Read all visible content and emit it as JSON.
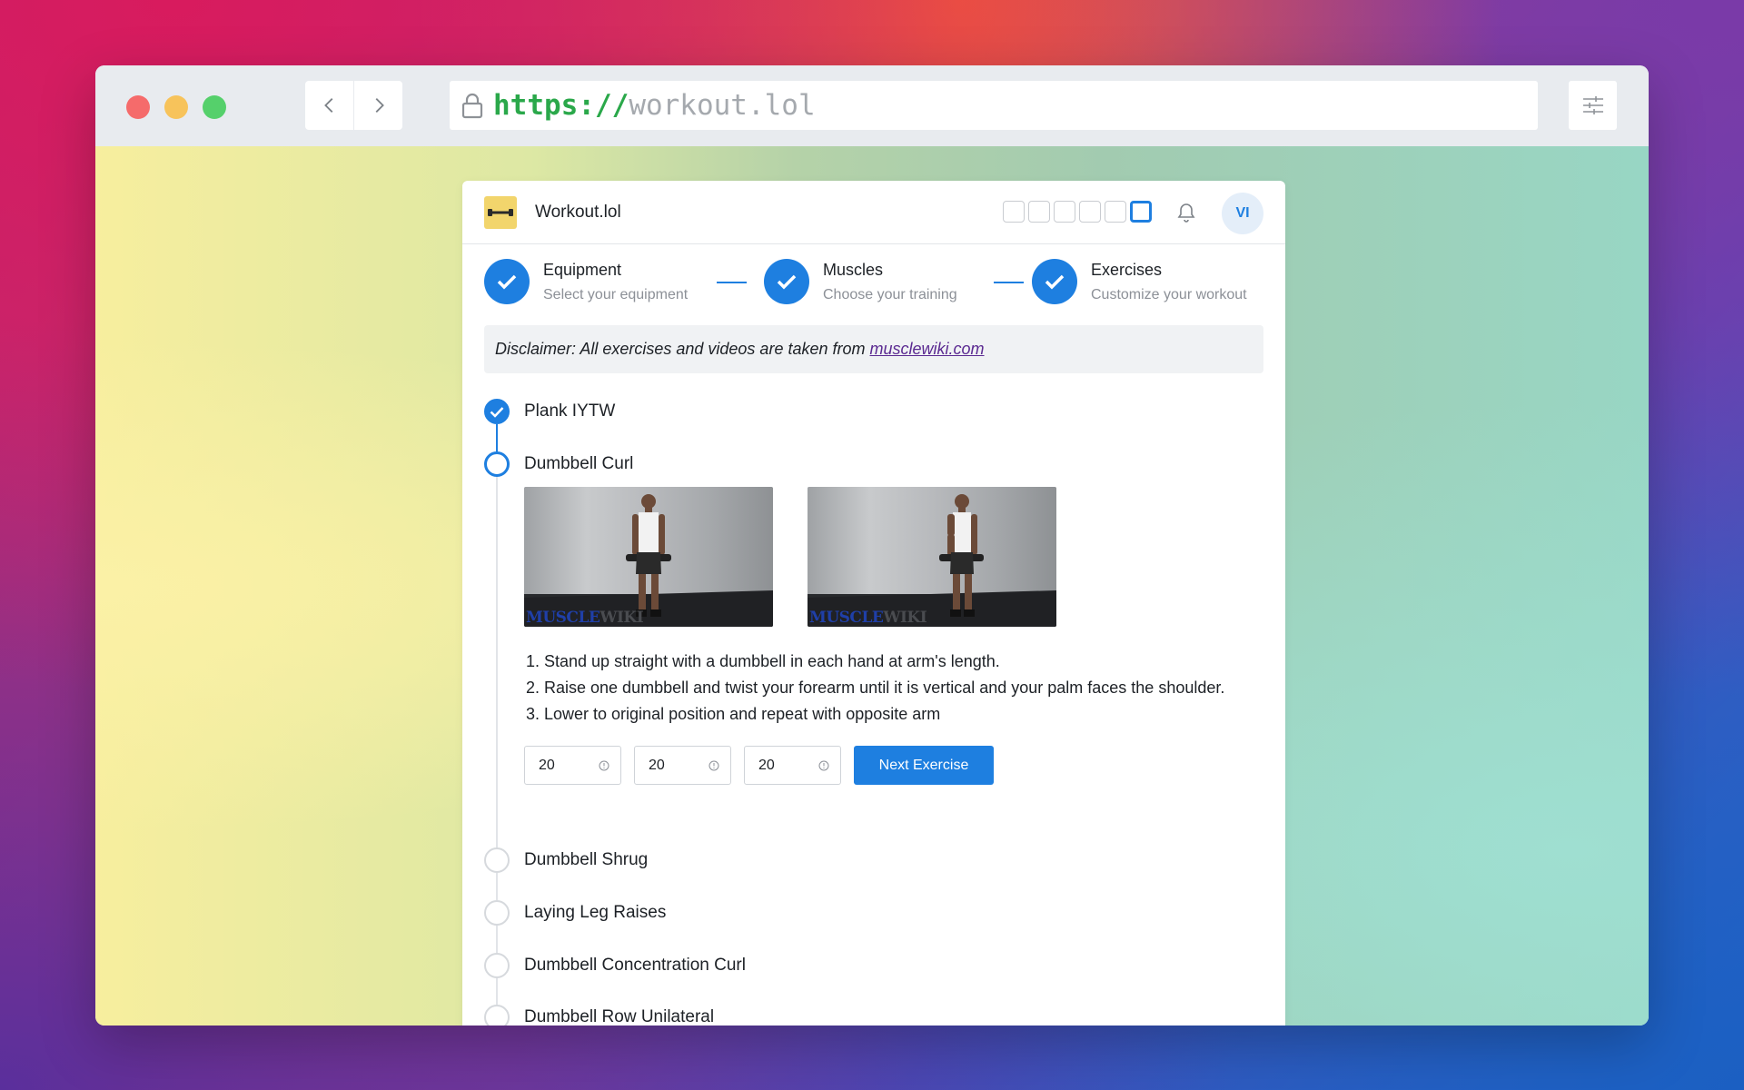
{
  "browser": {
    "url_scheme": "https://",
    "url_host": "workout.lol"
  },
  "app": {
    "brand": "Workout.lol",
    "avatar_initials": "VI",
    "accent_color": "#1e7fe0"
  },
  "stepper": [
    {
      "title": "Equipment",
      "subtitle": "Select your equipment"
    },
    {
      "title": "Muscles",
      "subtitle": "Choose your training"
    },
    {
      "title": "Exercises",
      "subtitle": "Customize your workout"
    }
  ],
  "disclaimer": {
    "text": "Disclaimer: All exercises and videos are taken from",
    "link": "musclewiki.com"
  },
  "exercises": [
    {
      "name": "Plank IYTW",
      "state": "done"
    },
    {
      "name": "Dumbbell Curl",
      "state": "current"
    },
    {
      "name": "Dumbbell Shrug",
      "state": "pending"
    },
    {
      "name": "Laying Leg Raises",
      "state": "pending"
    },
    {
      "name": "Dumbbell Concentration Curl",
      "state": "pending"
    },
    {
      "name": "Dumbbell Row Unilateral",
      "state": "pending"
    }
  ],
  "current_exercise": {
    "watermark_a": "MUSCLE",
    "watermark_b": "WIKI",
    "instructions": [
      "Stand up straight with a dumbbell in each hand at arm's length.",
      "Raise one dumbbell and twist your forearm until it is vertical and your palm faces the shoulder.",
      "Lower to original position and repeat with opposite arm"
    ],
    "inputs": [
      "20",
      "20",
      "20"
    ],
    "next_label": "Next Exercise"
  }
}
